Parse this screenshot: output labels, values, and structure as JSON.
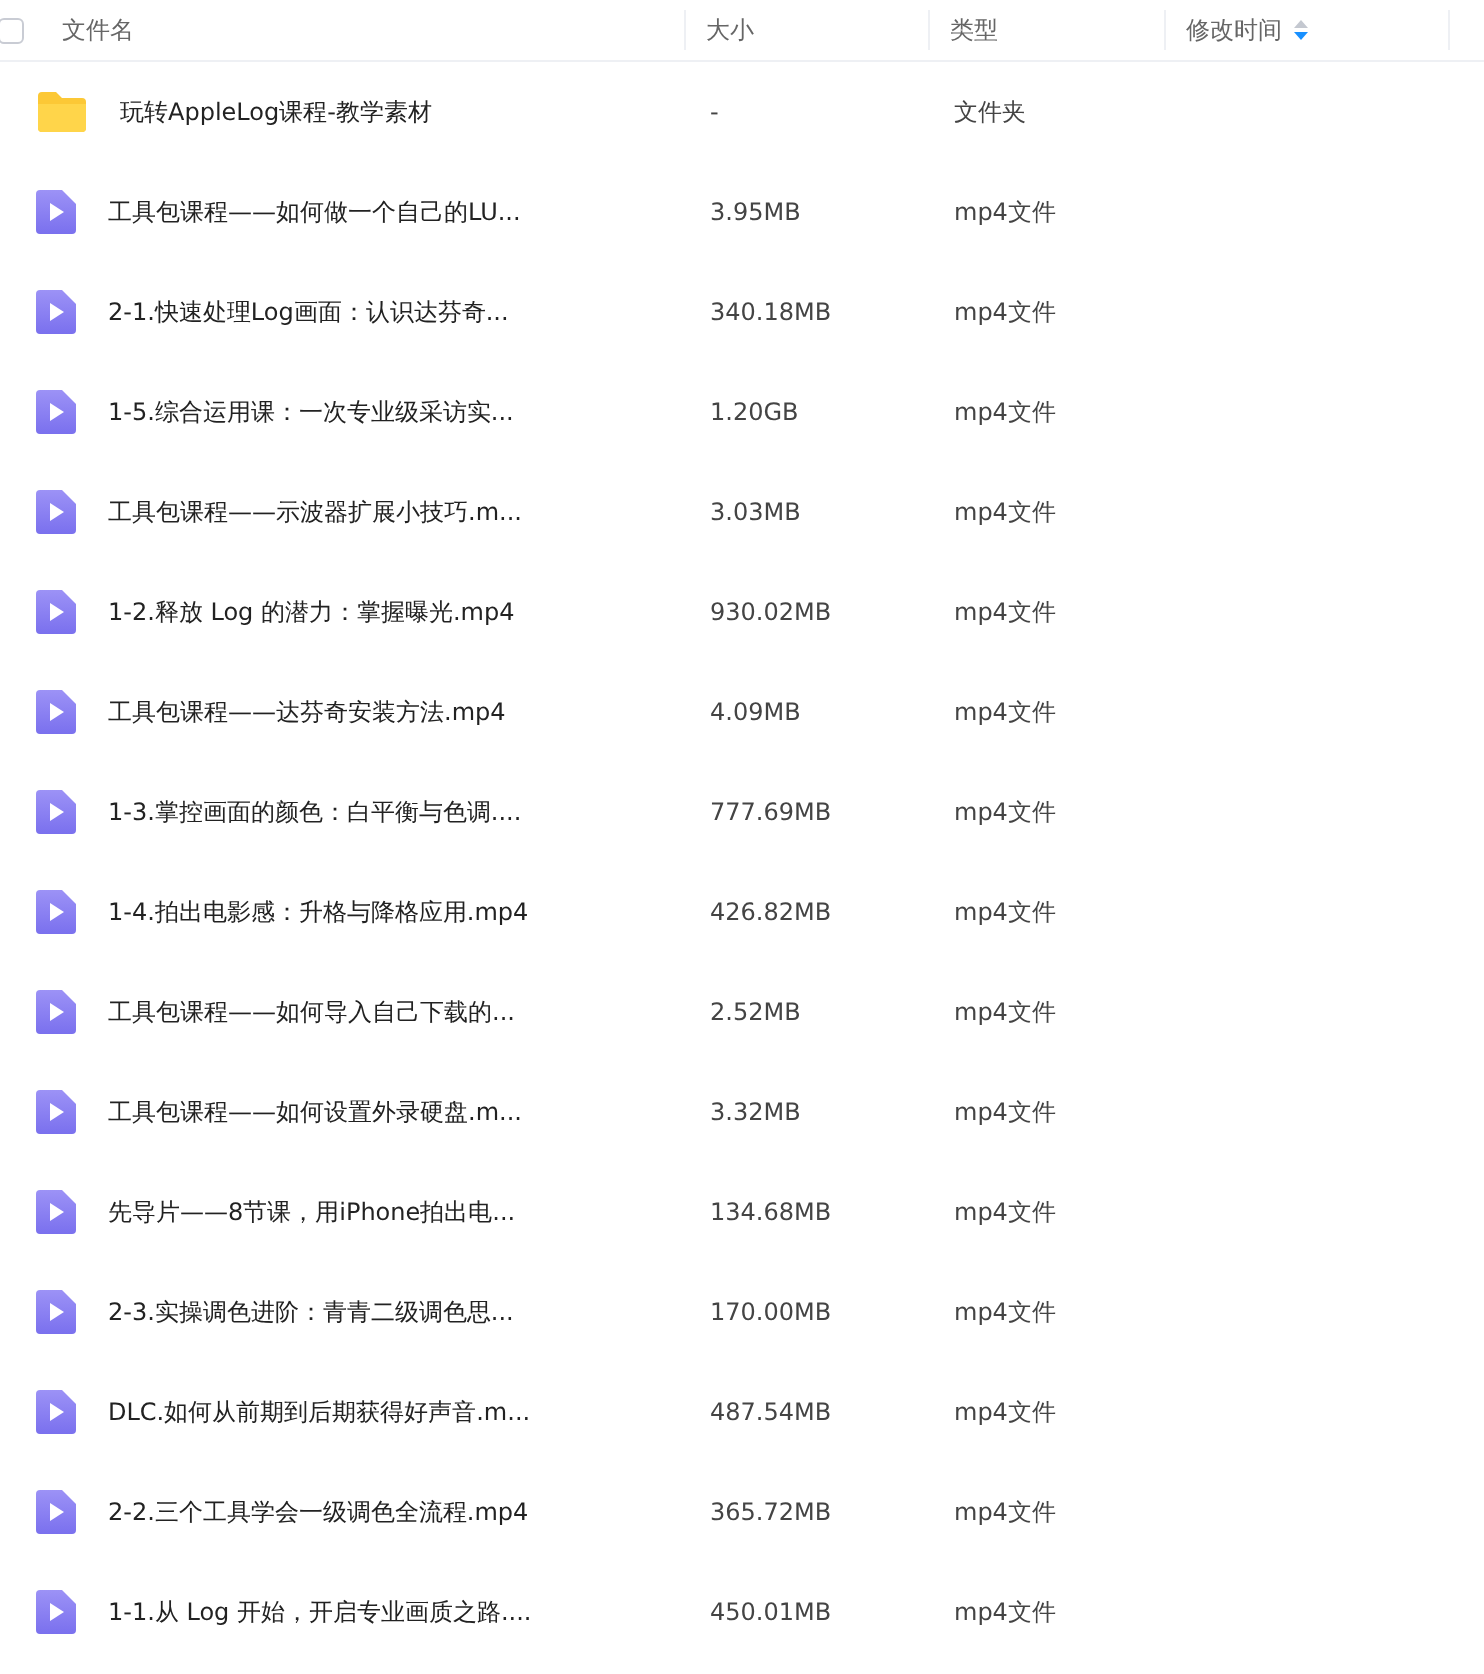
{
  "table": {
    "select_all": {
      "checked": false
    },
    "columns": [
      {
        "label": "文件名",
        "sortable": false
      },
      {
        "label": "大小",
        "sortable": false
      },
      {
        "label": "类型",
        "sortable": false
      },
      {
        "label": "修改时间",
        "sortable": true
      }
    ],
    "rows": [
      {
        "kind": "folder",
        "name": "玩转AppleLog课程-教学素材",
        "size": "-",
        "type": "文件夹"
      },
      {
        "kind": "video",
        "name": "工具包课程——如何做一个自己的LU...",
        "size": "3.95MB",
        "type": "mp4文件"
      },
      {
        "kind": "video",
        "name": "2-1.快速处理Log画面：认识达芬奇...",
        "size": "340.18MB",
        "type": "mp4文件"
      },
      {
        "kind": "video",
        "name": "1-5.综合运用课：一次专业级采访实...",
        "size": "1.20GB",
        "type": "mp4文件"
      },
      {
        "kind": "video",
        "name": "工具包课程——示波器扩展小技巧.m...",
        "size": "3.03MB",
        "type": "mp4文件"
      },
      {
        "kind": "video",
        "name": "1-2.释放 Log 的潜力：掌握曝光.mp4",
        "size": "930.02MB",
        "type": "mp4文件"
      },
      {
        "kind": "video",
        "name": "工具包课程——达芬奇安装方法.mp4",
        "size": "4.09MB",
        "type": "mp4文件"
      },
      {
        "kind": "video",
        "name": "1-3.掌控画面的颜色：白平衡与色调....",
        "size": "777.69MB",
        "type": "mp4文件"
      },
      {
        "kind": "video",
        "name": "1-4.拍出电影感：升格与降格应用.mp4",
        "size": "426.82MB",
        "type": "mp4文件"
      },
      {
        "kind": "video",
        "name": "工具包课程——如何导入自己下载的...",
        "size": "2.52MB",
        "type": "mp4文件"
      },
      {
        "kind": "video",
        "name": "工具包课程——如何设置外录硬盘.m...",
        "size": "3.32MB",
        "type": "mp4文件"
      },
      {
        "kind": "video",
        "name": "先导片——8节课，用iPhone拍出电...",
        "size": "134.68MB",
        "type": "mp4文件"
      },
      {
        "kind": "video",
        "name": "2-3.实操调色进阶：青青二级调色思...",
        "size": "170.00MB",
        "type": "mp4文件"
      },
      {
        "kind": "video",
        "name": "DLC.如何从前期到后期获得好声音.m...",
        "size": "487.54MB",
        "type": "mp4文件"
      },
      {
        "kind": "video",
        "name": "2-2.三个工具学会一级调色全流程.mp4",
        "size": "365.72MB",
        "type": "mp4文件"
      },
      {
        "kind": "video",
        "name": "1-1.从 Log 开始，开启专业画质之路....",
        "size": "450.01MB",
        "type": "mp4文件"
      }
    ]
  }
}
